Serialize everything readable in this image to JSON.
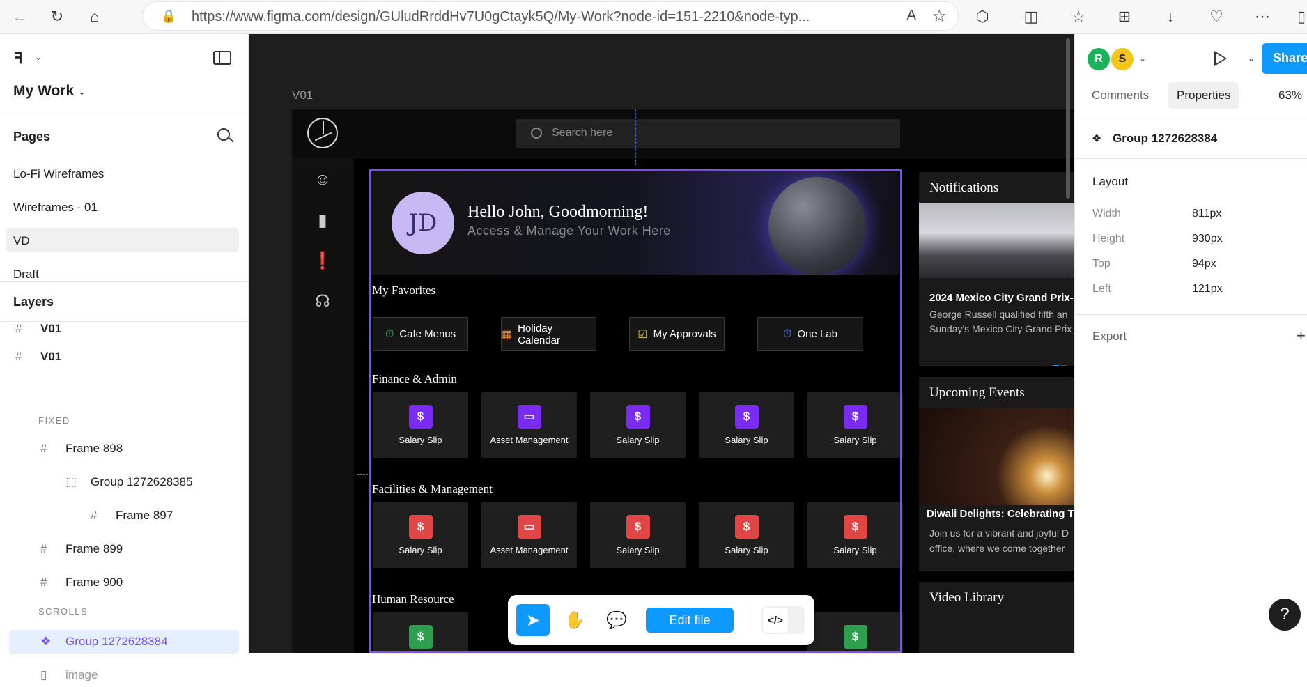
{
  "browser": {
    "url": "https://www.figma.com/design/GUludRrddHv7U0gCtayk5Q/My-Work?node-id=151-2210&node-typ..."
  },
  "left_panel": {
    "project": "My Work",
    "pages_title": "Pages",
    "pages": [
      "Lo-Fi Wireframes",
      "Wireframes - 01",
      "VD",
      "Draft"
    ],
    "layers_title": "Layers",
    "layers": [
      {
        "name": "V01",
        "label": "V01"
      },
      {
        "name": "V01",
        "label": "V01"
      },
      {
        "label": "FIXED"
      },
      {
        "label": "Frame 898"
      },
      {
        "label": "Group 1272628385"
      },
      {
        "label": "Frame 897"
      },
      {
        "label": "Frame 899"
      },
      {
        "label": "Frame 900"
      },
      {
        "label": "SCROLLS"
      },
      {
        "label": "Group 1272628384"
      },
      {
        "label": "image"
      }
    ]
  },
  "canvas": {
    "frame_label": "V01",
    "search_placeholder": "Search here",
    "avatar_initials": "JD",
    "greeting": "Hello John, Goodmorning!",
    "subgreeting": "Access & Manage Your Work Here",
    "favorites_title": "My Favorites",
    "favorites": [
      "Cafe Menus",
      "Holiday Calendar",
      "My Approvals",
      "One Lab"
    ],
    "finance_title": "Finance & Admin",
    "finance_tiles": [
      "Salary Slip",
      "Asset Management",
      "Salary Slip",
      "Salary Slip",
      "Salary Slip"
    ],
    "facilities_title": "Facilities & Management",
    "facilities_tiles": [
      "Salary Slip",
      "Asset Management",
      "Salary Slip",
      "Salary Slip",
      "Salary Slip"
    ],
    "hr_title": "Human Resource",
    "notifications": {
      "title": "Notifications",
      "headline": "2024 Mexico City Grand Prix-",
      "body_1": "George Russell qualified fifth an",
      "body_2": "Sunday's Mexico City Grand Prix"
    },
    "events": {
      "title": "Upcoming Events",
      "headline": "Diwali Delights: Celebrating T",
      "body_1": "Join us for a vibrant and joyful D",
      "body_2": "office, where we come together"
    },
    "video_title": "Video Library",
    "toolbar": {
      "edit_label": "Edit file",
      "code_label": "</>"
    }
  },
  "right_panel": {
    "avatars": [
      "R",
      "S"
    ],
    "share_label": "Share",
    "tabs": [
      "Comments",
      "Properties"
    ],
    "zoom": "63%",
    "selection_name": "Group 1272628384",
    "layout_title": "Layout",
    "props": [
      {
        "k": "Width",
        "v": "811px"
      },
      {
        "k": "Height",
        "v": "930px"
      },
      {
        "k": "Top",
        "v": "94px"
      },
      {
        "k": "Left",
        "v": "121px"
      }
    ],
    "export_title": "Export"
  },
  "colors": {
    "accent": "#0d99ff",
    "selection": "#7b4cff",
    "finance_icon": "#7b2cf2",
    "facilities_icon": "#e04646",
    "hr_icon": "#2e9e4f"
  }
}
